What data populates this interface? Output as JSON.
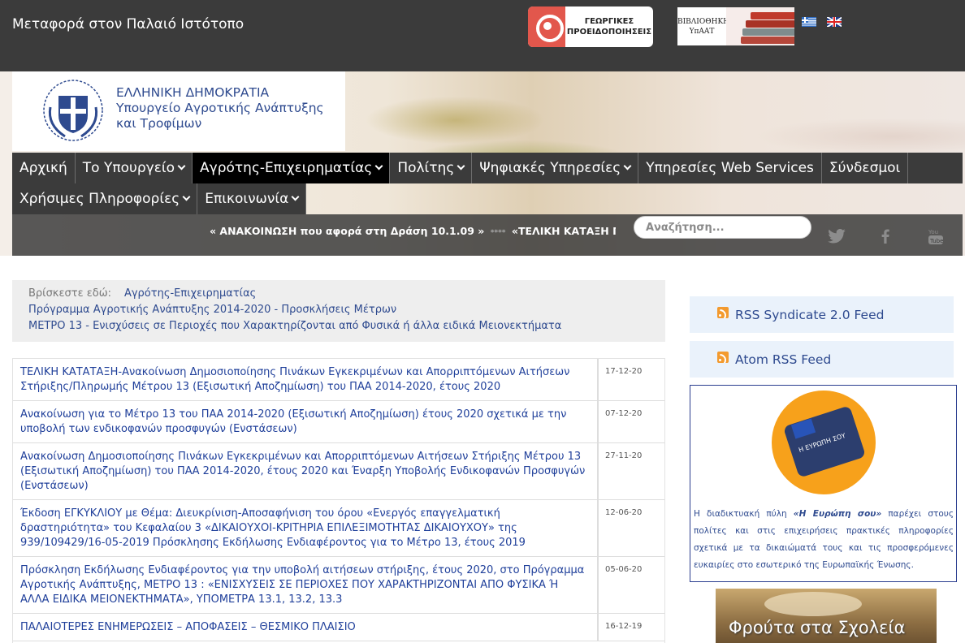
{
  "topbar": {
    "old_site_link": "Μεταφορά στον Παλαιό Ιστότοπο",
    "warnings_banner": "ΓΕΩΡΓΙΚΕΣ ΠΡΟΕΙΔΟΠΟΙΗΣΕΙΣ",
    "library_banner": "ΒΙΒΛΙΟΘΗΚΗ ΥπΑΑΤ"
  },
  "header": {
    "logo_line1": "ΕΛΛΗΝΙΚΗ ΔΗΜΟΚΡΑΤΙΑ",
    "logo_line2": "Υπουργείο Αγροτικής Ανάπτυξης",
    "logo_line3": "και Τροφίμων"
  },
  "nav": {
    "row1": [
      {
        "label": "Αρχική",
        "dropdown": false,
        "active": false
      },
      {
        "label": "Το Υπουργείο",
        "dropdown": true,
        "active": false
      },
      {
        "label": "Αγρότης-Επιχειρηματίας",
        "dropdown": true,
        "active": true
      },
      {
        "label": "Πολίτης",
        "dropdown": true,
        "active": false
      },
      {
        "label": "Ψηφιακές Υπηρεσίες",
        "dropdown": true,
        "active": false
      },
      {
        "label": "Υπηρεσίες Web Services",
        "dropdown": false,
        "active": false
      },
      {
        "label": "Σύνδεσμοι",
        "dropdown": false,
        "active": false
      }
    ],
    "row2": [
      {
        "label": "Χρήσιμες Πληροφορίες",
        "dropdown": true,
        "active": false
      },
      {
        "label": "Επικοινωνία",
        "dropdown": true,
        "active": false
      }
    ]
  },
  "ticker": {
    "item1": "« ΑΝΑΚΟΙΝΩΣΗ που αφορά στη Δράση 10.1.09 »",
    "separator": "****",
    "item2": "«ΤΕΛΙΚΗ ΚΑΤΑΞΗ ΠΙΝΑΚΩΝ"
  },
  "search": {
    "placeholder": "Αναζήτηση..."
  },
  "social": [
    "twitter-icon",
    "facebook-icon",
    "youtube-icon"
  ],
  "breadcrumb": {
    "label": "Βρίσκεστε εδώ:",
    "items": [
      "Αγρότης-Επιχειρηματίας",
      "Πρόγραμμα Αγροτικής Ανάπτυξης 2014-2020 - Προσκλήσεις Μέτρων",
      "ΜΕΤΡΟ 13 - Ενισχύσεις σε Περιοχές που Χαρακτηρίζονται από Φυσικά ή άλλα ειδικά Μειονεκτήματα"
    ]
  },
  "articles": [
    {
      "title": "ΤΕΛΙΚΗ ΚΑΤΑΤΑΞΗ-Ανακοίνωση Δημοσιοποίησης Πινάκων Εγκεκριμένων και Απορριπτόμενων Αιτήσεων Στήριξης/Πληρωμής  Μέτρου 13 (Εξισωτική Αποζημίωση) του ΠΑΑ 2014-2020, έτους 2020",
      "date": "17-12-20"
    },
    {
      "title": "Ανακοίνωση για το Μέτρο 13 του ΠΑΑ 2014-2020 (Εξισωτική Αποζημίωση) έτους 2020 σχετικά με την υποβολή των ενδικοφανών προσφυγών  (Ενστάσεων)",
      "date": "07-12-20"
    },
    {
      "title": "Ανακοίνωση Δημοσιοποίησης Πινάκων Εγκεκριμένων και Απορριπτόμενων Αιτήσεων Στήριξης Μέτρου 13 (Εξισωτική Αποζημίωση) του ΠΑΑ 2014-2020, έτους 2020 και Έναρξη Υποβολής Ενδικοφανών Προσφυγών (Ενστάσεων)",
      "date": "27-11-20"
    },
    {
      "title": "Έκδοση ΕΓΚΥΚΛΙΟΥ με Θέμα: Διευκρίνιση-Αποσαφήνιση του όρου «Ενεργός επαγγελματική δραστηριότητα» του Κεφαλαίου 3 «ΔΙΚΑΙΟΥΧΟΙ-ΚΡΙΤΗΡΙΑ ΕΠΙΛΕΞΙΜΟΤΗΤΑΣ ΔΙΚΑΙΟΥΧΟΥ» της 939/109429/16-05-2019 Πρόσκλησης Εκδήλωσης Ενδιαφέροντος για το Μέτρο 13, έτους 2019",
      "date": "12-06-20"
    },
    {
      "title": "Πρόσκληση Εκδήλωσης Ενδιαφέροντος για την υποβολή αιτήσεων στήριξης, έτους 2020, στο Πρόγραμμα Αγροτικής Ανάπτυξης, ΜΕΤΡΟ 13 : «ΕΝΙΣΧΥΣΕΙΣ ΣΕ ΠΕΡΙΟΧΕΣ ΠΟΥ ΧΑΡΑΚΤΗΡΙΖΟΝΤΑΙ ΑΠΟ ΦΥΣΙΚΑ Ή ΑΛΛΑ ΕΙΔΙΚΑ ΜΕΙΟΝΕΚΤΗΜΑΤΑ», ΥΠΟΜΕΤΡΑ 13.1, 13.2, 13.3",
      "date": "05-06-20"
    },
    {
      "title": "ΠΑΛΑΙΟΤΕΡΕΣ ΕΝΗΜΕΡΩΣΕΙΣ – ΑΠΟΦΑΣΕΙΣ – ΘΕΣΜΙΚΟ ΠΛΑΙΣΙΟ",
      "date": "16-12-19"
    }
  ],
  "sidebar": {
    "rss_feed": "RSS Syndicate 2.0 Feed",
    "atom_feed": "Atom RSS Feed",
    "europe_badge_text": "Η ΕΥΡΩΠΗ ΣΟΥ",
    "europe_text_before": "Η διαδικτυακή πύλη ",
    "europe_text_em": "«Η Ευρώπη σου»",
    "europe_text_after": " παρέχει στους πολίτες και στις επιχειρήσεις πρακτικές πληροφορίες σχετικά με τα δικαιώματά τους και τις προσφερόμενες ευκαιρίες στο εσωτερικό της Ευρωπαϊκής Ένωσης.",
    "fruit_banner": "Φρούτα στα Σχολεία"
  },
  "colors": {
    "topbar": "#3b3b3b",
    "link": "#1f3f9a",
    "rss": "#f39a2e",
    "feed_bg": "#eaf2fb"
  }
}
